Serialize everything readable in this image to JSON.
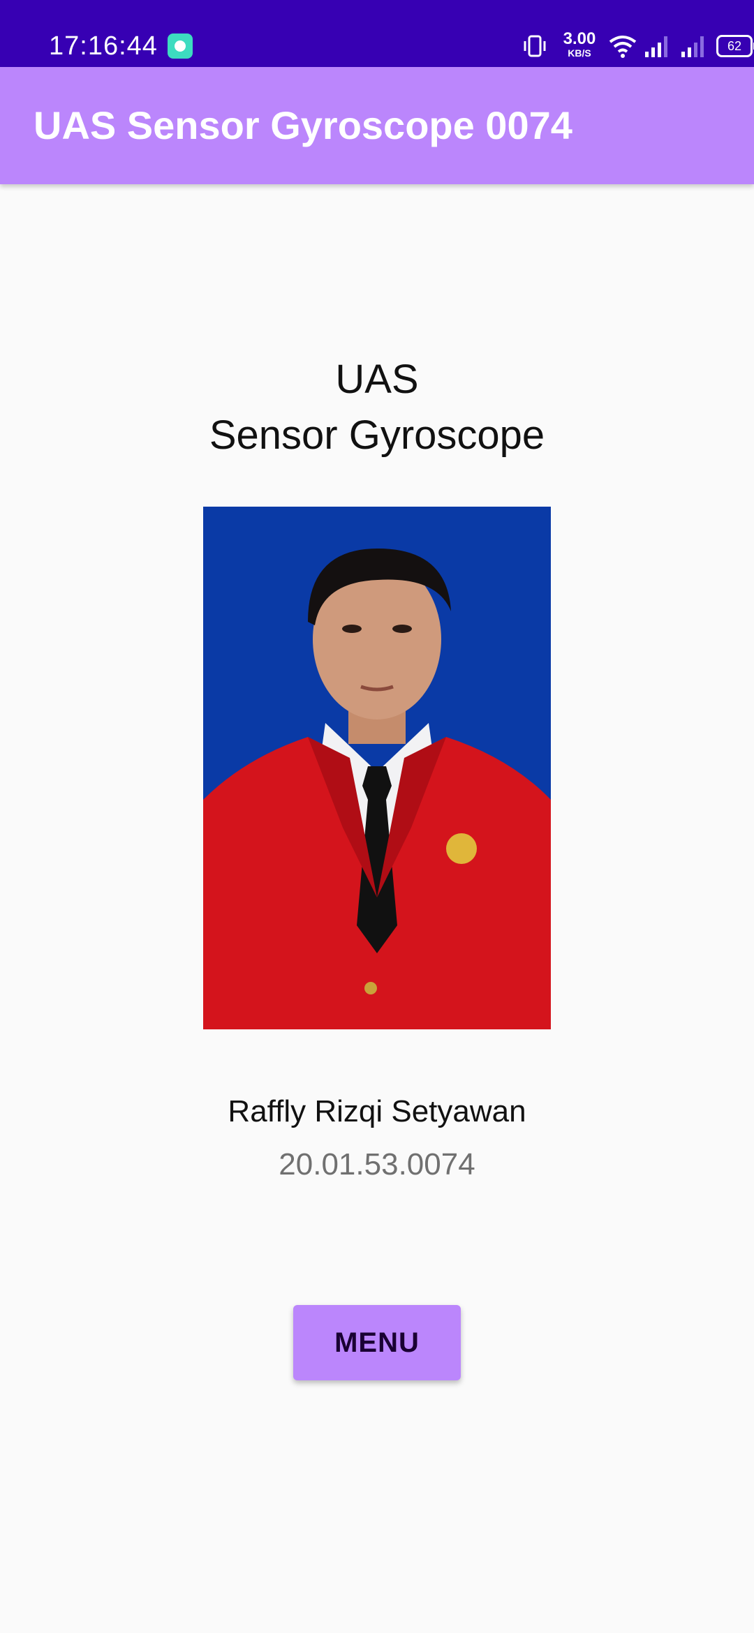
{
  "status_bar": {
    "time": "17:16:44",
    "net_speed_value": "3.00",
    "net_speed_unit": "KB/S",
    "battery": "62",
    "notification_icon": "chat-bubble-icon",
    "icons": [
      "vibrate-icon",
      "wifi-icon",
      "signal-icon",
      "signal-icon",
      "battery-icon"
    ]
  },
  "app_bar": {
    "title": "UAS Sensor Gyroscope 0074"
  },
  "main": {
    "heading_line1": "UAS",
    "heading_line2": "Sensor Gyroscope",
    "photo": "profile-photo",
    "name": "Raffly Rizqi Setyawan",
    "student_id": "20.01.53.0074",
    "menu_button": "MENU"
  },
  "colors": {
    "status_bar": "#3700b3",
    "app_bar": "#bb86fc",
    "button": "#bb86fc",
    "photo_background": "#0a3aa6",
    "jacket": "#d4141c"
  }
}
